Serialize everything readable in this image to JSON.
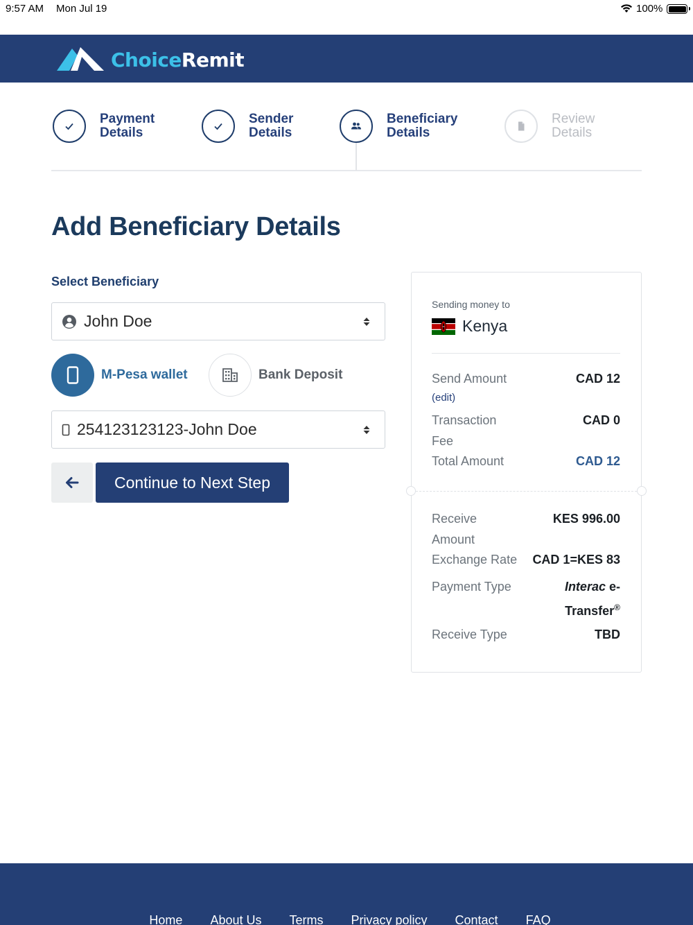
{
  "status_bar": {
    "time": "9:57 AM",
    "date": "Mon Jul 19",
    "battery_percent": "100%"
  },
  "brand": {
    "name_part1": "Choice",
    "name_part2": "Remit"
  },
  "stepper": [
    {
      "line1": "Payment",
      "line2": "Details",
      "state": "done"
    },
    {
      "line1": "Sender",
      "line2": "Details",
      "state": "done"
    },
    {
      "line1": "Beneficiary",
      "line2": "Details",
      "state": "current"
    },
    {
      "line1": "Review",
      "line2": "Details",
      "state": "pending"
    }
  ],
  "page": {
    "title": "Add Beneficiary Details"
  },
  "form": {
    "select_label": "Select Beneficiary",
    "beneficiary_value": "John Doe",
    "methods": [
      {
        "label": "M-Pesa wallet",
        "selected": true
      },
      {
        "label": "Bank Deposit",
        "selected": false
      }
    ],
    "wallet_value": "254123123123-John Doe",
    "continue_label": "Continue to Next Step"
  },
  "summary": {
    "sending_to_label": "Sending money to",
    "country": "Kenya",
    "send_amount_label": "Send Amount",
    "send_amount": "CAD 12",
    "edit_label": "(edit)",
    "fee_label_1": "Transaction",
    "fee_label_2": "Fee",
    "fee": "CAD 0",
    "total_label": "Total Amount",
    "total": "CAD 12",
    "receive_label_1": "Receive",
    "receive_label_2": "Amount",
    "receive_amount": "KES 996.00",
    "rate_label": "Exchange Rate",
    "rate": "CAD 1=KES 83",
    "payment_type_label": "Payment Type",
    "payment_type_brand": "Interac",
    "payment_type_rest_1": "e-",
    "payment_type_rest_2": "Transfer",
    "registered_mark": "®",
    "receive_type_label": "Receive Type",
    "receive_type": "TBD"
  },
  "footer": {
    "links": [
      "Home",
      "About Us",
      "Terms",
      "Privacy policy",
      "Contact",
      "FAQ"
    ]
  },
  "colors": {
    "navy": "#243f75",
    "accent_blue": "#2e6a9c",
    "logo_cyan": "#3cc0e8"
  }
}
